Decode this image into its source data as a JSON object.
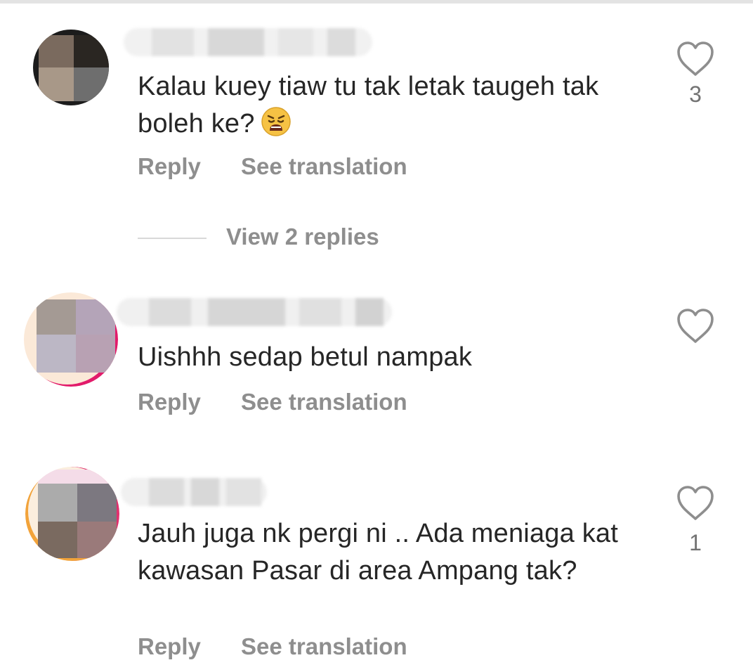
{
  "comments": [
    {
      "text": "Kalau kuey tiaw tu tak letak taugeh tak boleh ke?",
      "emoji": "weary-face",
      "like_count": "3",
      "reply_label": "Reply",
      "translate_label": "See translation"
    },
    {
      "text": "Uishhh sedap betul nampak",
      "like_count": "",
      "reply_label": "Reply",
      "translate_label": "See translation"
    },
    {
      "text": "Jauh juga nk pergi ni .. Ada meniaga kat kawasan Pasar di area Ampang tak?",
      "like_count": "1",
      "reply_label": "Reply",
      "translate_label": "See translation"
    }
  ],
  "view_replies_label": "View 2 replies",
  "icons": {
    "like": "heart-outline-icon",
    "emoji": "weary-face-emoji"
  },
  "colors": {
    "text": "#262626",
    "secondary": "#8e8e8e",
    "like_count": "#737373",
    "divider": "#d8d8d8"
  }
}
